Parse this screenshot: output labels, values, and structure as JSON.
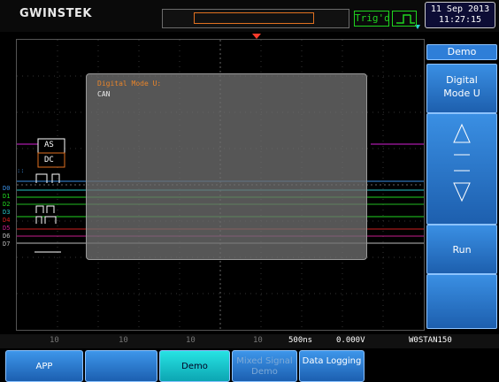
{
  "header": {
    "logo": "GWINSTEK",
    "trigger_status": "Trig'd",
    "date": "11 Sep 2013",
    "time": "11:27:15"
  },
  "channels": {
    "labels": [
      "D0",
      "D1",
      "D2",
      "D3",
      "D4",
      "D5",
      "D6",
      "D7"
    ],
    "bus_labels": [
      "AS",
      "DC"
    ]
  },
  "dialog": {
    "title": "Digital Mode U:",
    "value": "CAN"
  },
  "side_menu": {
    "title": "Demo",
    "mode_line1": "Digital",
    "mode_line2": "Mode U",
    "run_label": "Run"
  },
  "status_bar": {
    "channel_scales": [
      "10",
      "10",
      "10",
      "10"
    ],
    "timebase": "500ns",
    "trigger_level": "0.000V",
    "sample_rate": "W0STAN150"
  },
  "softkeys": [
    {
      "label": "APP",
      "state": "normal"
    },
    {
      "label": "",
      "state": "empty"
    },
    {
      "label": "Demo",
      "state": "active"
    },
    {
      "label": "Mixed Signal Demo",
      "state": "disabled"
    },
    {
      "label": "Data Logging",
      "state": "normal"
    }
  ],
  "colors": {
    "accent": "#2e7ed8",
    "dialog_title": "#e8842a",
    "trigger": "#1fd31f",
    "ch_magenta": "#d41fd4"
  }
}
